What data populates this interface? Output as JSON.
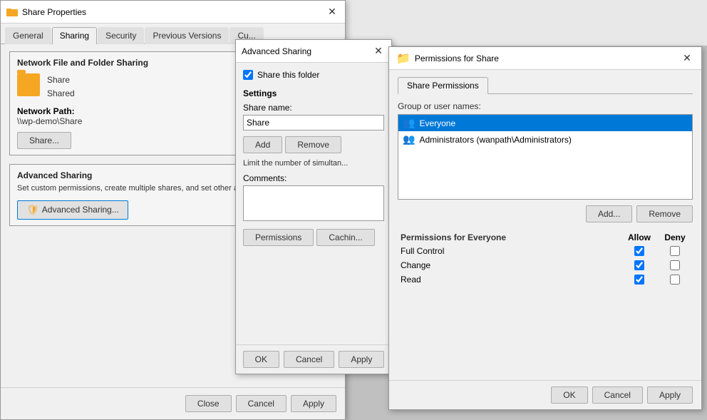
{
  "shareProperties": {
    "title": "Share Properties",
    "tabs": [
      {
        "label": "General",
        "active": false
      },
      {
        "label": "Sharing",
        "active": true
      },
      {
        "label": "Security",
        "active": false
      },
      {
        "label": "Previous Versions",
        "active": false
      },
      {
        "label": "Cu...",
        "active": false
      }
    ],
    "networkSharing": {
      "sectionTitle": "Network File and Folder Sharing",
      "shareName": "Share",
      "shareStatus": "Shared",
      "networkPathLabel": "Network Path:",
      "networkPath": "\\\\wp-demo\\Share",
      "shareButton": "Share..."
    },
    "advancedSharing": {
      "sectionTitle": "Advanced Sharing",
      "description": "Set custom permissions, create multiple shares, and set other advanced sharing options.",
      "buttonLabel": "Advanced Sharing..."
    },
    "footer": {
      "closeLabel": "Close",
      "cancelLabel": "Cancel",
      "applyLabel": "Apply"
    }
  },
  "advancedSharingDialog": {
    "title": "Advanced Sharing",
    "shareThisFolder": "Share this folder",
    "shareThisFolderChecked": true,
    "settingsLabel": "Settings",
    "shareNameLabel": "Share name:",
    "shareNameValue": "Share",
    "addLabel": "Add",
    "removeLabel": "Remove",
    "limitLabel": "Limit the number of simultan...",
    "commentsLabel": "Comments:",
    "permissionsLabel": "Permissions",
    "cachingLabel": "Cachin...",
    "okLabel": "OK",
    "cancelLabel": "Cancel",
    "applyLabel": "Apply"
  },
  "permissionsDialog": {
    "title": "Permissions for Share",
    "tabs": [
      {
        "label": "Share Permissions",
        "active": true
      }
    ],
    "groupUsersLabel": "Group or user names:",
    "users": [
      {
        "name": "Everyone",
        "selected": true
      },
      {
        "name": "Administrators (wanpath\\Administrators)",
        "selected": false
      }
    ],
    "addLabel": "Add...",
    "removeLabel": "Remove",
    "permissionsFor": "Permissions for Everyone",
    "allowLabel": "Allow",
    "denyLabel": "Deny",
    "permissions": [
      {
        "name": "Full Control",
        "allow": true,
        "deny": false
      },
      {
        "name": "Change",
        "allow": true,
        "deny": false
      },
      {
        "name": "Read",
        "allow": true,
        "deny": false
      }
    ],
    "okLabel": "OK",
    "cancelLabel": "Cancel",
    "applyLabel": "Apply"
  }
}
